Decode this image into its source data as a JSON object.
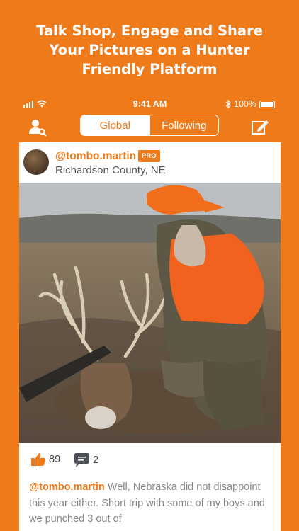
{
  "promo": {
    "line1": "Talk Shop, Engage and Share",
    "line2": "Your Pictures on a Hunter",
    "line3": "Friendly Platform"
  },
  "status_bar": {
    "time": "9:41 AM",
    "battery": "100%"
  },
  "nav": {
    "tabs": [
      {
        "label": "Global",
        "selected": true
      },
      {
        "label": "Following",
        "selected": false
      }
    ],
    "left_icon": "user-search-icon",
    "right_icon": "compose-icon"
  },
  "post": {
    "username": "@tombo.martin",
    "badge": "PRO",
    "location": "Richardson County, NE",
    "likes": "89",
    "comments": "2",
    "caption_user": "@tombo.martin",
    "caption_text": "Well, Nebraska did not disappoint this year either. Short trip with some of my boys and we punched 3 out of"
  },
  "colors": {
    "accent": "#ef7a1a",
    "white": "#ffffff"
  }
}
